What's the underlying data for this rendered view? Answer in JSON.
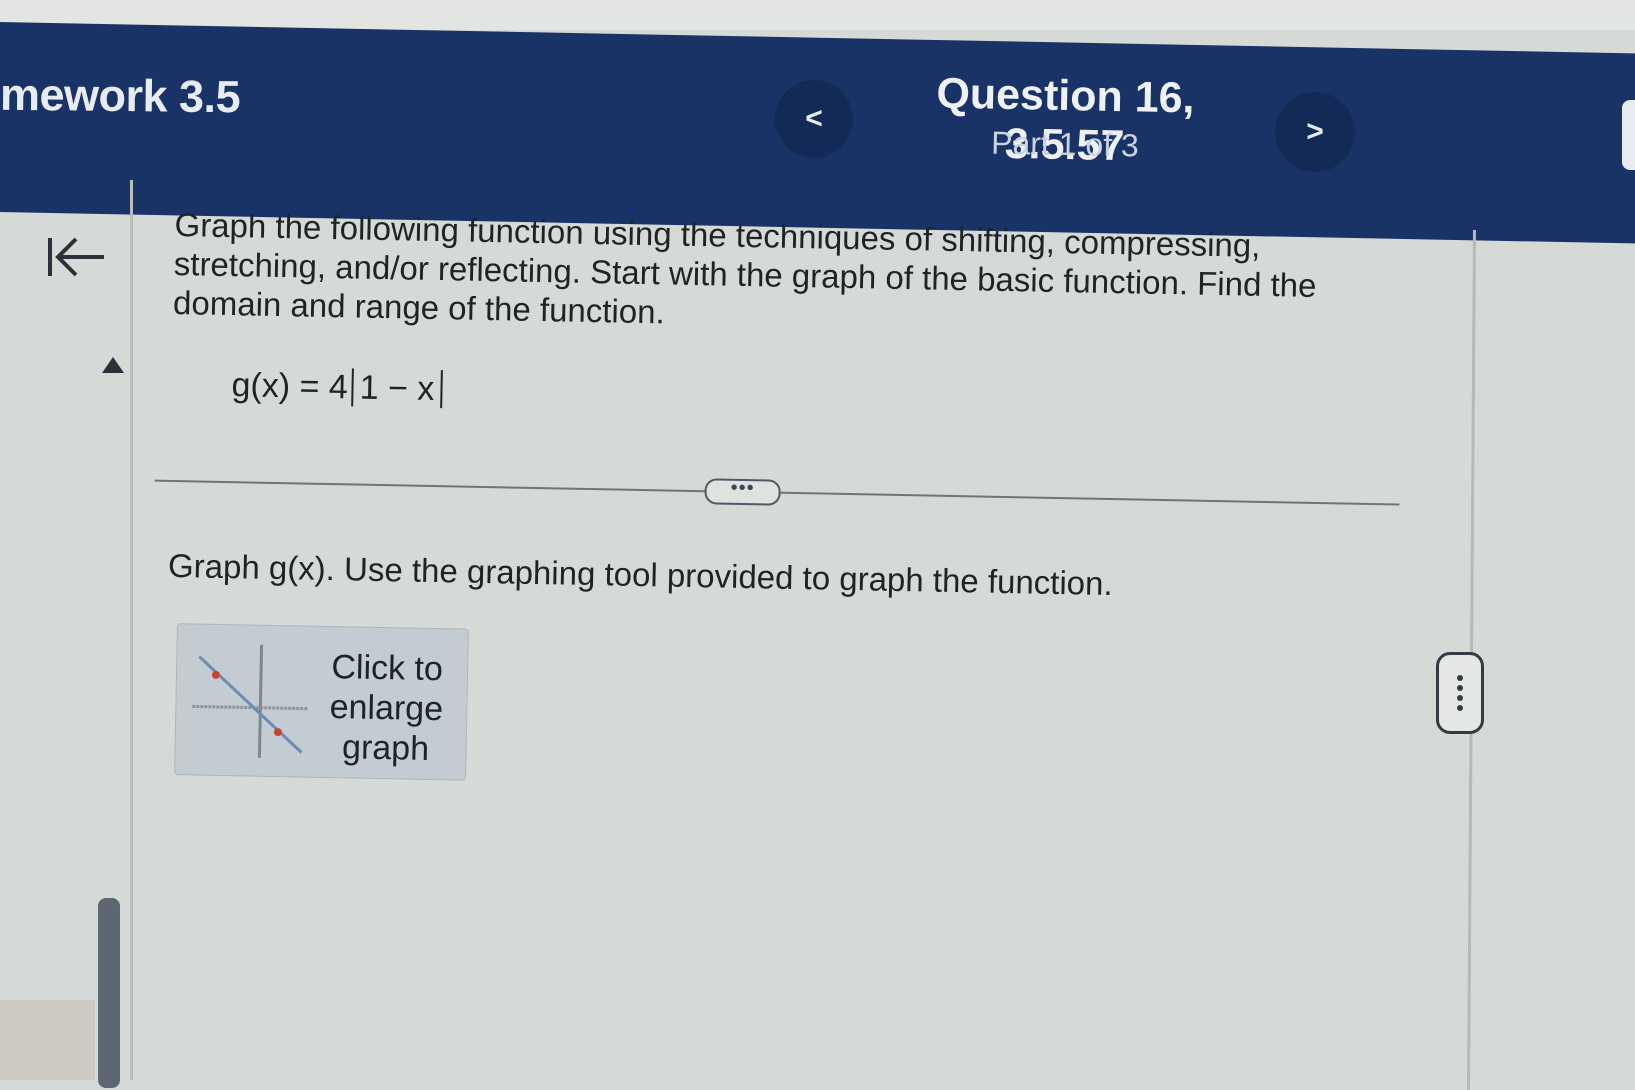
{
  "header": {
    "assignment_title": "mework 3.5",
    "question_title": "Question 16, 3.5.57",
    "question_part": "Part 1 of 3",
    "prev_label": "<",
    "next_label": ">"
  },
  "sidebar": {
    "collapse_icon": "collapse-left-icon",
    "scroll_up_icon": "up-arrow-icon"
  },
  "question": {
    "instructions": "Graph the following function using the techniques of shifting, compressing, stretching, and/or reflecting. Start with the graph of the basic function. Find the domain and range of the function.",
    "function_lhs": "g(x) = 4",
    "function_abs": "1 − x",
    "expand_label": "•••",
    "prompt": "Graph g(x). Use the graphing tool provided to graph the function.",
    "enlarge_label": "Click to enlarge graph"
  },
  "more_options_icon": "vertical-ellipsis-icon"
}
